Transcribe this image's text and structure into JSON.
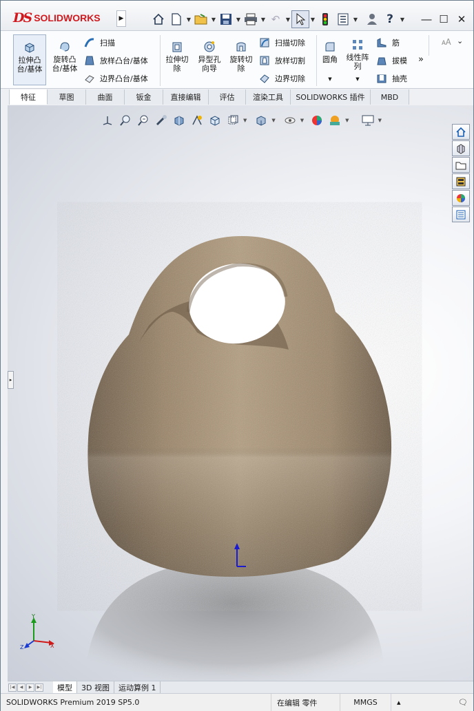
{
  "app": {
    "brand": "SOLIDWORKS",
    "ds_mark": "DS"
  },
  "quick_access": {
    "home": "home-icon",
    "new": "new-doc-icon",
    "open": "open-folder-icon",
    "save": "save-icon",
    "print": "print-icon",
    "undo": "undo-icon",
    "select": "select-arrow-icon",
    "rebuild": "traffic-light-icon",
    "options": "options-icon",
    "user": "user-icon",
    "help": "?"
  },
  "ribbon": {
    "extrude_boss": "拉伸凸\n台/基体",
    "revolve_boss": "旋转凸\n台/基体",
    "sweep": "扫描",
    "loft_boss": "放样凸台/基体",
    "boundary_boss": "边界凸台/基体",
    "extrude_cut": "拉伸切\n除",
    "hole_wizard": "异型孔\n向导",
    "revolve_cut": "旋转切\n除",
    "swept_cut": "扫描切除",
    "lofted_cut": "放样切割",
    "boundary_cut": "边界切除",
    "fillet": "圆角",
    "linear_pattern": "线性阵\n列",
    "rib": "筋",
    "draft": "拔模",
    "shell": "抽壳",
    "more": "»"
  },
  "tabs": [
    {
      "label": "特征",
      "active": true
    },
    {
      "label": "草图"
    },
    {
      "label": "曲面"
    },
    {
      "label": "钣金"
    },
    {
      "label": "直接编辑"
    },
    {
      "label": "评估"
    },
    {
      "label": "渲染工具"
    },
    {
      "label": "SOLIDWORKS 插件"
    },
    {
      "label": "MBD"
    }
  ],
  "triad": {
    "x": "X",
    "y": "Y",
    "z": "Z"
  },
  "bottom_tabs": [
    {
      "label": "模型",
      "active": true
    },
    {
      "label": "3D 视图"
    },
    {
      "label": "运动算例 1"
    }
  ],
  "status": {
    "product": "SOLIDWORKS Premium 2019 SP5.0",
    "editing": "在编辑 零件",
    "units": "MMGS"
  },
  "colors": {
    "brand_red": "#d0191e",
    "model_tan": "#a58d70",
    "accent_blue": "#1a5fb4"
  }
}
